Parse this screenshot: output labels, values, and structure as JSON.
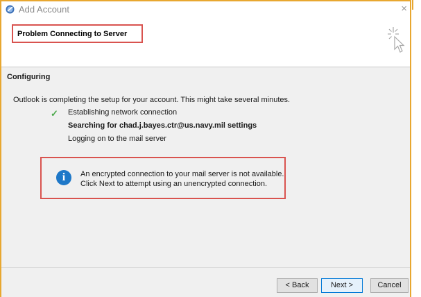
{
  "window": {
    "title": "Add Account",
    "close_glyph": "×",
    "icon": "outlook-account-icon"
  },
  "header": {
    "title": "Problem Connecting to Server",
    "icon": "wizard-cursor-icon"
  },
  "section": {
    "title": "Configuring"
  },
  "progress": {
    "intro": "Outlook is completing the setup for your account. This might take several minutes.",
    "steps": [
      {
        "label": "Establishing network connection",
        "status": "done"
      },
      {
        "label": "Searching for chad.j.bayes.ctr@us.navy.mil settings",
        "status": "active"
      },
      {
        "label": "Logging on to the mail server",
        "status": "pending"
      }
    ]
  },
  "message": {
    "icon": "info-icon",
    "line1": "An encrypted connection to your mail server is not available.",
    "line2": "Click Next to attempt using an unencrypted connection."
  },
  "buttons": {
    "back": "< Back",
    "next": "Next >",
    "cancel": "Cancel"
  },
  "colors": {
    "highlight_border": "#d9534f",
    "outer_frame": "#e8a730",
    "info_blue": "#1e78c8",
    "check_green": "#4aa84a"
  }
}
